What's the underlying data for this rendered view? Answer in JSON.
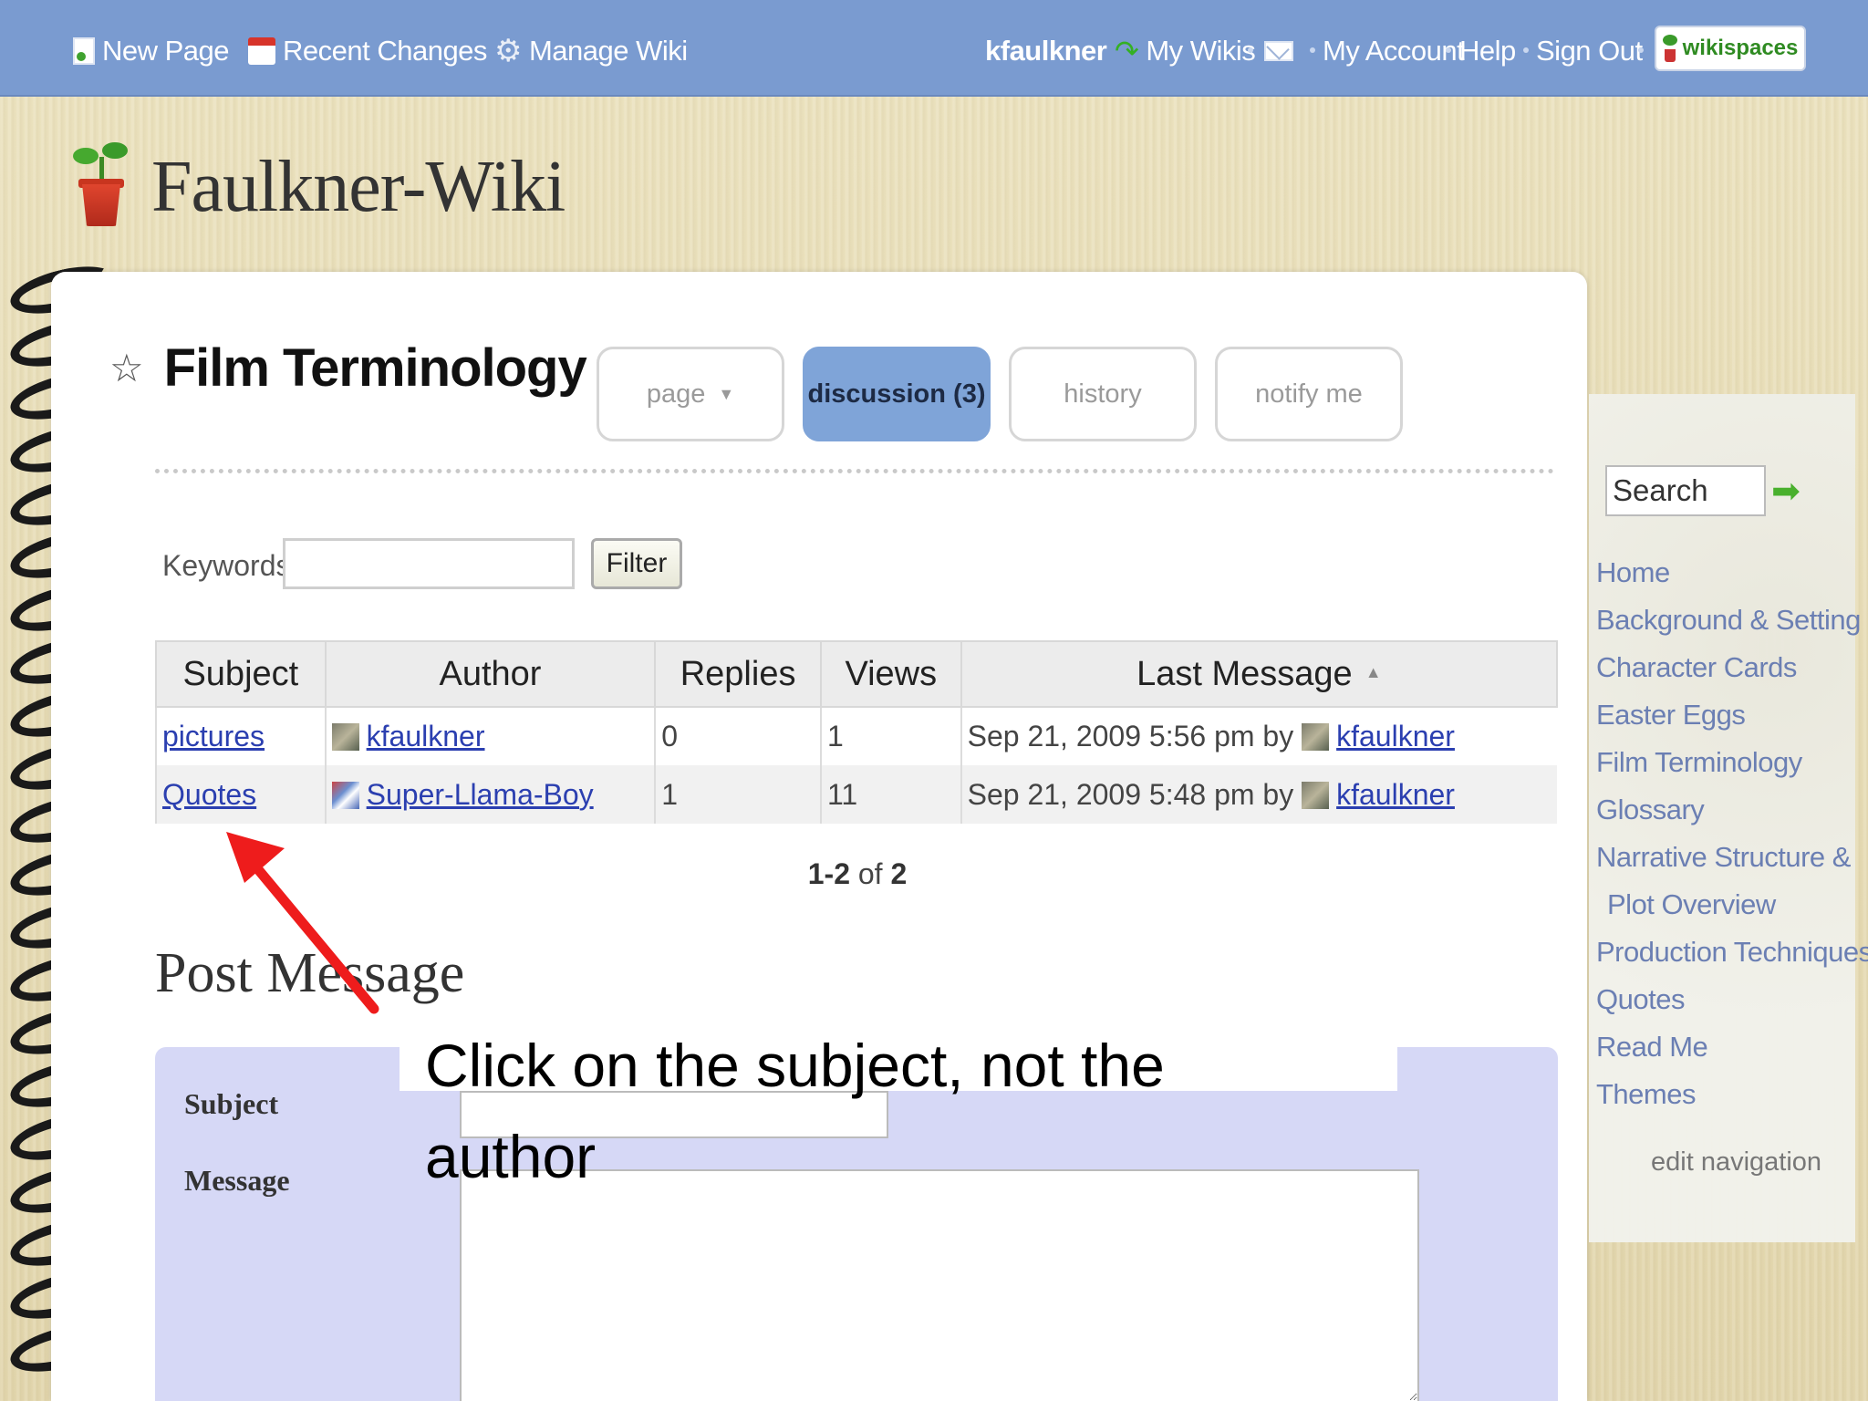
{
  "topbar": {
    "new_page": "New Page",
    "recent_changes": "Recent Changes",
    "manage_wiki": "Manage Wiki",
    "username": "kfaulkner",
    "my_wikis": "My Wikis",
    "my_account": "My Account",
    "help": "Help",
    "sign_out": "Sign Out",
    "brand": "wikispaces",
    "bar_color": "#7a9bd0"
  },
  "wiki": {
    "title": "Faulkner-Wiki"
  },
  "page": {
    "title": "Film Terminology",
    "tabs": [
      {
        "label": "page",
        "active": false
      },
      {
        "label": "discussion (3)",
        "active": true
      },
      {
        "label": "history",
        "active": false
      },
      {
        "label": "notify me",
        "active": false
      }
    ]
  },
  "filter": {
    "keywords_label": "Keywords",
    "keywords_value": "",
    "button_label": "Filter"
  },
  "table": {
    "headers": [
      "Subject",
      "Author",
      "Replies",
      "Views",
      "Last Message"
    ],
    "rows": [
      {
        "subject": "pictures",
        "author": "kfaulkner",
        "replies": "0",
        "views": "1",
        "last_message_date": "Sep 21, 2009 5:56 pm by",
        "last_message_by": "kfaulkner"
      },
      {
        "subject": "Quotes",
        "author": "Super-Llama-Boy",
        "replies": "1",
        "views": "11",
        "last_message_date": "Sep 21, 2009 5:48 pm by",
        "last_message_by": "kfaulkner"
      }
    ]
  },
  "pager": {
    "range": "1-2",
    "of_word": "of",
    "total": "2"
  },
  "post": {
    "title": "Post Message",
    "subject_label": "Subject",
    "message_label": "Message",
    "subject_value": "",
    "message_value": ""
  },
  "annotation": {
    "text": "Click on the subject, not the author",
    "arrow_color": "#ee1c1c"
  },
  "sidebar": {
    "search_placeholder": "Search",
    "links": [
      "Home",
      "Background & Setting",
      "Character Cards",
      "Easter Eggs",
      "Film Terminology",
      "Glossary",
      "Narrative Structure &",
      "Plot Overview",
      "Production Techniques",
      "Quotes",
      "Read Me",
      "Themes"
    ],
    "edit_navigation": "edit navigation"
  }
}
